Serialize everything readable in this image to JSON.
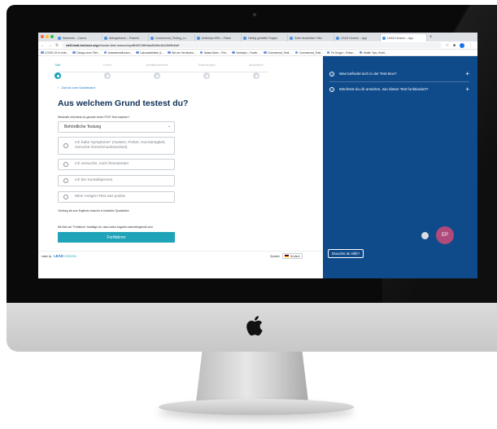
{
  "browser": {
    "tabs": [
      {
        "label": "Startseite – Canva"
      },
      {
        "label": "Abfragebaum – Präsent"
      },
      {
        "label": "Commercial_Testing_Lo"
      },
      {
        "label": "Antikörpe 89% – Präse"
      },
      {
        "label": "Häufig gestellte Fragen"
      },
      {
        "label": "Seite bearbeiten 'Häu"
      },
      {
        "label": "LEAD Horizon – App"
      },
      {
        "label": "LEAD Horizon – App"
      }
    ],
    "url_domain": "dell.lead-horizon.org",
    "url_path": "/choose-test-reason/xyz8b6013ffefaa3bb5c46c0bf5b6a9",
    "bookmarks": [
      "COVID-19 in Unte...",
      "Design ohne Titel...",
      "Anweisemethoden...",
      "Laborwarteliste (L...",
      "Bei der Vermischu...",
      "Ablauf Aktor – Prä...",
      "Vorlesijni – Faceb...",
      "Commercial_Testi...",
      "Commercial_Testi...",
      "Fb Gurgel – Präse...",
      "Health Tips, Healt..."
    ]
  },
  "steps": [
    {
      "label": "Start"
    },
    {
      "label": "Person"
    },
    {
      "label": "Identitätsnachweis"
    },
    {
      "label": "Testkiosungen"
    },
    {
      "label": "Abschließen"
    }
  ],
  "form": {
    "back_link": "Zurück zum Dashboard",
    "title": "Aus welchem Grund testest du?",
    "question_label": "Weshalb möchtest du gerade einen PCR Test machen?",
    "select_value": "Behördliche Testung",
    "options": [
      {
        "label": "Ich habe Symptome* (Husten, Fieber, Kurzatmigkeit, Geruchs-/Geschmacksverlust)"
      },
      {
        "label": "Ich versuche, mich freizutesten"
      },
      {
        "label": "Ich bin Kontaktperson"
      },
      {
        "label": "Mein Antigen-Test war positiv"
      }
    ],
    "note": "*Achtung bis zum Ergebnis musst du in häusliche Quarantäne",
    "consent": "Mit Klick auf \"Fortfahren\" bestätige ich, dass meine Angaben wahrheitsgemäß sind",
    "submit_label": "Fortfahren"
  },
  "footer": {
    "made_by": "made by",
    "brand": "LEAD",
    "brand_suffix": "HORIZON",
    "language_label": "Sprache",
    "language_value": "Deutsch"
  },
  "sidebar": {
    "faq": [
      {
        "question": "Was befindet sich in der Test-Box?"
      },
      {
        "question": "Möchtest du dir ansehen, wie dieser Test funktioniert?"
      }
    ],
    "avatar_initials": "EP",
    "help_button": "Brauchst du Hilfe?"
  },
  "colors": {
    "accent": "#1fa3b8",
    "sidebar_bg": "#0f4a8a",
    "title": "#0f2f57",
    "avatar": "#b04a7a"
  }
}
